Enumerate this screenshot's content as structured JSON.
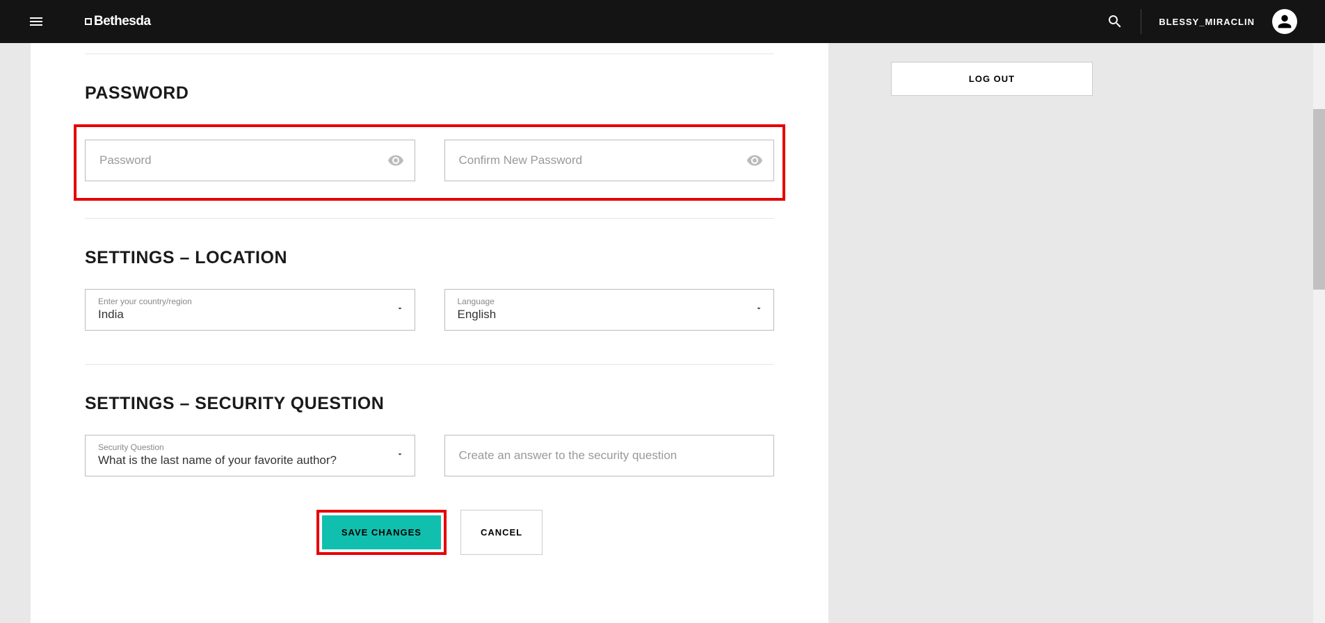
{
  "header": {
    "logo_text": "Bethesda",
    "username": "BLESSY_MIRACLIN"
  },
  "sidebar": {
    "logout_label": "LOG OUT"
  },
  "sections": {
    "password": {
      "title": "PASSWORD",
      "password_placeholder": "Password",
      "confirm_placeholder": "Confirm New Password"
    },
    "location": {
      "title": "SETTINGS – LOCATION",
      "country_label": "Enter your country/region",
      "country_value": "India",
      "language_label": "Language",
      "language_value": "English"
    },
    "security": {
      "title": "SETTINGS – SECURITY QUESTION",
      "question_label": "Security Question",
      "question_value": "What is the last name of your favorite author?",
      "answer_placeholder": "Create an answer to the security question"
    }
  },
  "buttons": {
    "save": "SAVE CHANGES",
    "cancel": "CANCEL"
  }
}
